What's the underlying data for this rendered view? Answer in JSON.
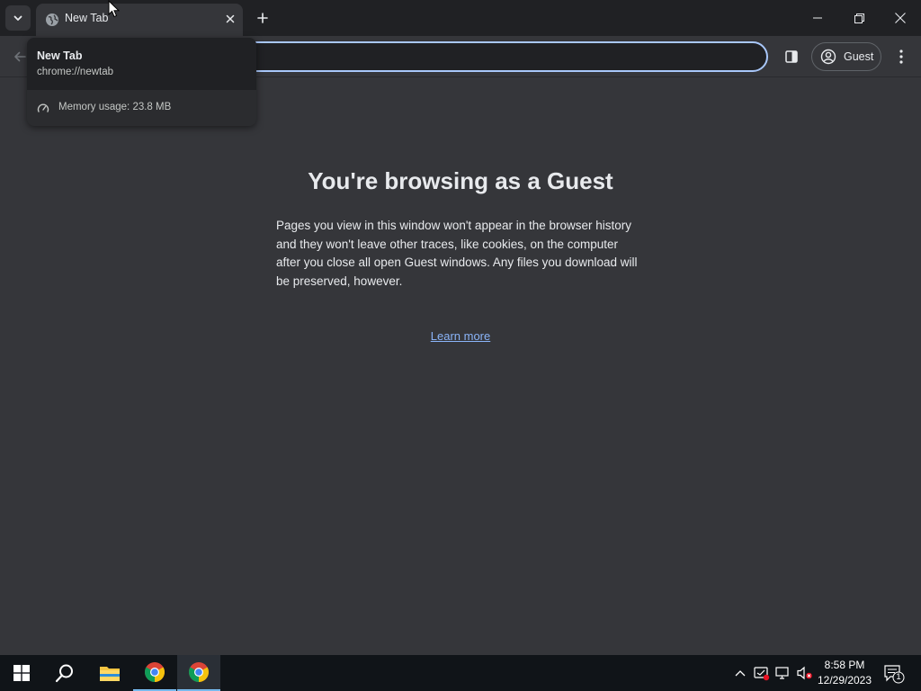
{
  "browser": {
    "tab": {
      "title": "New Tab",
      "favicon": "globe-icon"
    },
    "hovercard": {
      "title": "New Tab",
      "url": "chrome://newtab",
      "memory": "Memory usage: 23.8 MB"
    },
    "toolbar": {
      "profile_label": "Guest",
      "omnibox_value": ""
    },
    "accent_color": "#a8c7fa"
  },
  "page": {
    "title": "You're browsing as a Guest",
    "description": "Pages you view in this window won't appear in the browser history and they won't leave other traces, like cookies, on the computer after you close all open Guest windows. Any files you download will be preserved, however.",
    "learn_more": "Learn more",
    "link_color": "#8ab4f8"
  },
  "taskbar": {
    "apps": [
      "start-icon",
      "search-icon",
      "file-explorer-icon",
      "chrome-icon",
      "chrome-icon"
    ],
    "clock": {
      "time": "8:58 PM",
      "date": "12/29/2023"
    },
    "notification_count": "1"
  }
}
